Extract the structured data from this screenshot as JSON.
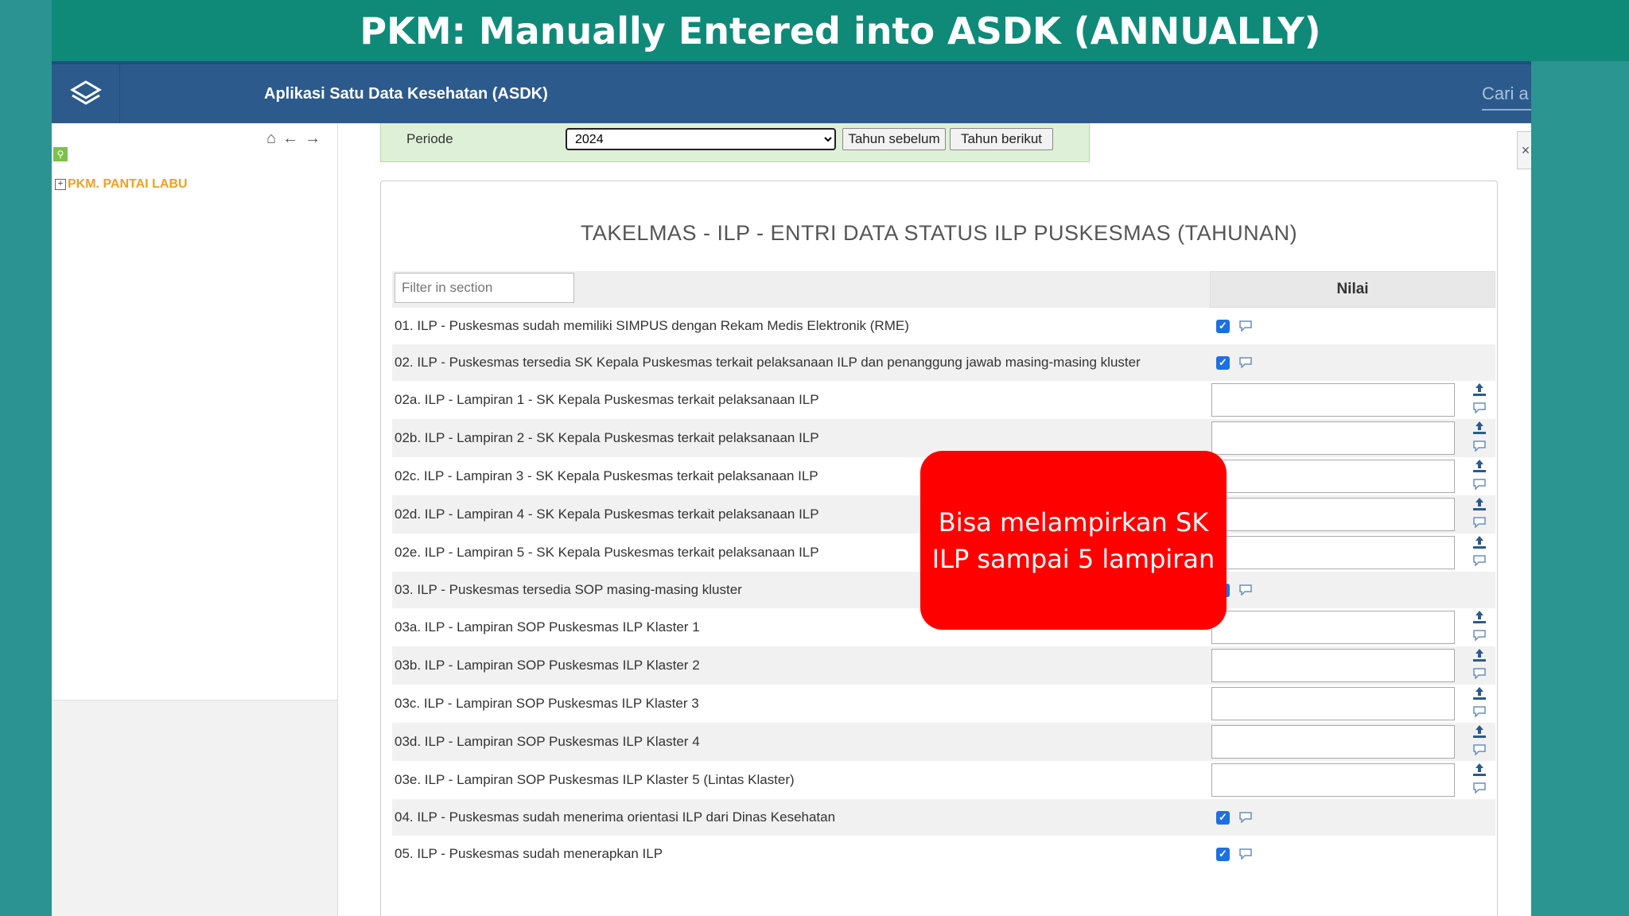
{
  "slide": {
    "title": "PKM: Manually Entered into ASDK (ANNUALLY)"
  },
  "app": {
    "title": "Aplikasi Satu Data Kesehatan (ASDK)",
    "search_text": "Cari a"
  },
  "sidebar": {
    "tree_root": "PKM. PANTAI LABU"
  },
  "period": {
    "label": "Periode",
    "selected": "2024",
    "prev_label": "Tahun sebelum",
    "next_label": "Tahun berikut"
  },
  "form": {
    "title": "TAKELMAS - ILP - ENTRI DATA STATUS ILP PUSKESMAS (TAHUNAN)",
    "filter_placeholder": "Filter in section",
    "value_header": "Nilai",
    "rows": [
      {
        "label": "01. ILP - Puskesmas sudah memiliki SIMPUS dengan Rekam Medis Elektronik (RME)",
        "type": "checkbox",
        "checked": true
      },
      {
        "label": "02. ILP - Puskesmas tersedia SK Kepala Puskesmas terkait pelaksanaan ILP dan penanggung jawab masing-masing kluster",
        "type": "checkbox",
        "checked": true
      },
      {
        "label": "02a. ILP - Lampiran 1 - SK Kepala Puskesmas terkait pelaksanaan ILP",
        "type": "file"
      },
      {
        "label": "02b. ILP - Lampiran 2 - SK Kepala Puskesmas terkait pelaksanaan ILP",
        "type": "file"
      },
      {
        "label": "02c. ILP - Lampiran 3 - SK Kepala Puskesmas terkait pelaksanaan ILP",
        "type": "file"
      },
      {
        "label": "02d. ILP - Lampiran 4 - SK Kepala Puskesmas terkait pelaksanaan ILP",
        "type": "file"
      },
      {
        "label": "02e. ILP - Lampiran 5 - SK Kepala Puskesmas terkait pelaksanaan ILP",
        "type": "file"
      },
      {
        "label": "03. ILP - Puskesmas tersedia SOP masing-masing kluster",
        "type": "checkbox",
        "checked": true
      },
      {
        "label": "03a. ILP - Lampiran SOP Puskesmas ILP Klaster 1",
        "type": "file"
      },
      {
        "label": "03b. ILP - Lampiran SOP Puskesmas ILP Klaster 2",
        "type": "file"
      },
      {
        "label": "03c. ILP - Lampiran SOP Puskesmas ILP Klaster 3",
        "type": "file"
      },
      {
        "label": "03d. ILP - Lampiran SOP Puskesmas ILP Klaster 4",
        "type": "file"
      },
      {
        "label": "03e. ILP - Lampiran SOP Puskesmas ILP Klaster 5 (Lintas Klaster)",
        "type": "file"
      },
      {
        "label": "04. ILP - Puskesmas sudah menerima orientasi ILP dari Dinas Kesehatan",
        "type": "checkbox",
        "checked": true
      },
      {
        "label": "05. ILP - Puskesmas sudah menerapkan ILP",
        "type": "checkbox",
        "checked": true
      }
    ]
  },
  "callout": {
    "text": "Bisa melampirkan SK ILP sampai 5 lampiran"
  },
  "colors": {
    "header_teal": "#0f8a78",
    "topbar_blue": "#2c5a8c",
    "callout_red": "#ff0000",
    "checkbox_blue": "#1e6fe0"
  },
  "icons": [
    "layers-logo-icon",
    "home-icon",
    "arrow-left-icon",
    "arrow-right-icon",
    "search-icon",
    "upload-icon",
    "comment-icon"
  ]
}
